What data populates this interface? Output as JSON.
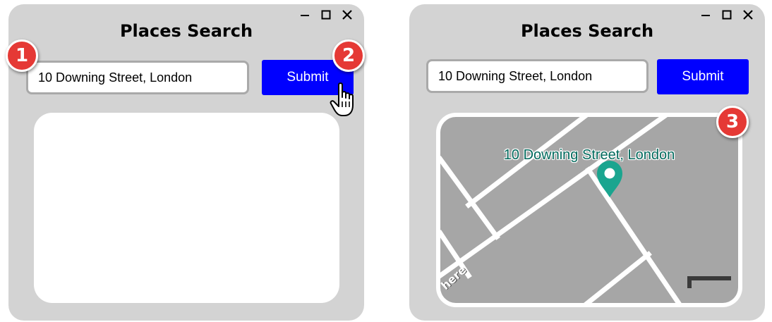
{
  "left_window": {
    "title": "Places Search",
    "address_value": "10 Downing Street, London",
    "submit_label": "Submit"
  },
  "right_window": {
    "title": "Places Search",
    "address_value": "10 Downing Street, London",
    "submit_label": "Submit",
    "map": {
      "marker_label": "10 Downing Street, London",
      "provider_logo": "here",
      "background_color": "#a6a6a6",
      "road_color": "#ffffff",
      "marker_color": "#1aa58f"
    }
  },
  "step_badges": [
    "1",
    "2",
    "3"
  ],
  "window_controls": [
    "minimize-icon",
    "maximize-icon",
    "close-icon"
  ],
  "colors": {
    "window_bg": "#d3d3d3",
    "button_bg": "#0000ff",
    "badge_bg": "#e53935"
  },
  "cursor": "pointer-hand-icon"
}
